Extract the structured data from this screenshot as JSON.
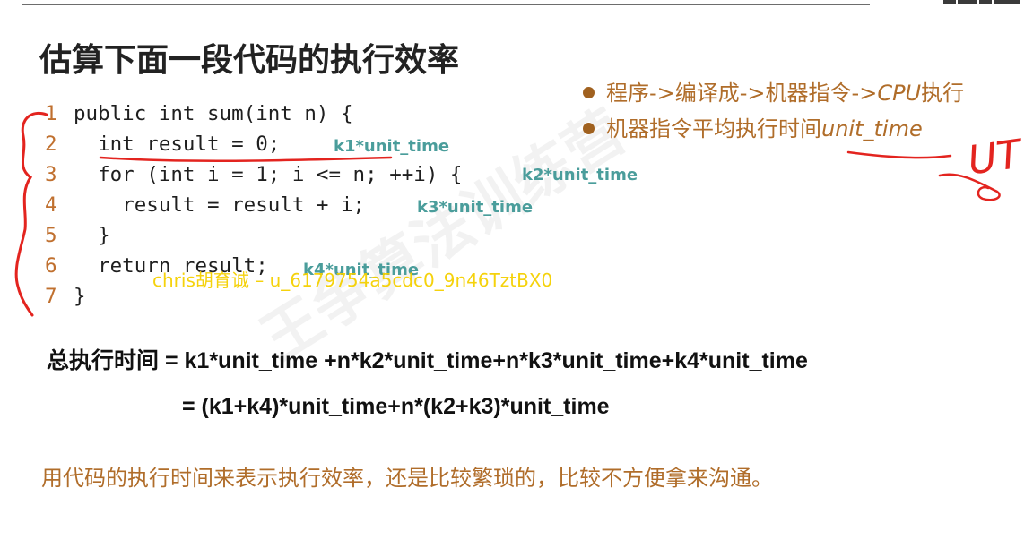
{
  "slide": {
    "title": "估算下面一段代码的执行效率",
    "bullets": [
      {
        "text": "程序->编译成->机器指令->",
        "emph": "CPU",
        "tail": "执行"
      },
      {
        "text": "机器指令平均执行时间",
        "emph": "unit_time",
        "tail": ""
      }
    ],
    "code_lines": [
      {
        "num": "1",
        "code": "public int sum(int n) {"
      },
      {
        "num": "2",
        "code": "  int result = 0;"
      },
      {
        "num": "3",
        "code": "  for (int i = 1; i <= n; ++i) {"
      },
      {
        "num": "4",
        "code": "    result = result + i;"
      },
      {
        "num": "5",
        "code": "  }"
      },
      {
        "num": "6",
        "code": "  return result;"
      },
      {
        "num": "7",
        "code": "}"
      }
    ],
    "costs": [
      "k1*unit_time",
      "k2*unit_time",
      "k3*unit_time",
      "k4*unit_time"
    ],
    "formula": {
      "label": "总执行时间",
      "line1": " = k1*unit_time +n*k2*unit_time+n*k3*unit_time+k4*unit_time",
      "line2": "= (k1+k4)*unit_time+n*(k2+k3)*unit_time"
    },
    "note": "用代码的执行时间来表示执行效率，还是比较繁琐的，比较不方便拿来沟通。",
    "handwriting": "UT",
    "watermark": "chris胡育诚 – u_6179754a5cdc0_9n46TztBX0",
    "background_watermark": "王争算法训练营",
    "colors": {
      "title": "#222222",
      "bullet_text": "#b06d2a",
      "line_numbers": "#c0702f",
      "cost_annotation": "#4a9d9b",
      "pen": "#e3241f",
      "watermark": "#f5d000"
    }
  }
}
